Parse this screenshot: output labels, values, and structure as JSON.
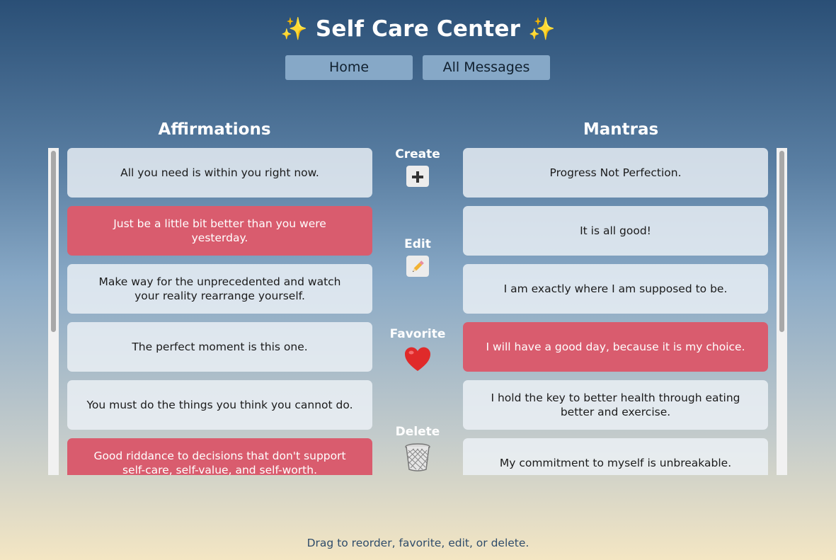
{
  "header": {
    "title": "✨ Self Care Center ✨"
  },
  "nav": {
    "home_label": "Home",
    "all_messages_label": "All Messages"
  },
  "affirmations": {
    "heading": "Affirmations",
    "items": [
      {
        "text": "All you need is within you right now.",
        "favorite": false
      },
      {
        "text": "Just be a little bit better than you were yesterday.",
        "favorite": true
      },
      {
        "text": "Make way for the unprecedented and watch your reality rearrange yourself.",
        "favorite": false
      },
      {
        "text": "The perfect moment is this one.",
        "favorite": false
      },
      {
        "text": "You must do the things you think you cannot do.",
        "favorite": false
      },
      {
        "text": "Good riddance to decisions that don't support self-care, self-value, and self-worth.",
        "favorite": true
      }
    ]
  },
  "mantras": {
    "heading": "Mantras",
    "items": [
      {
        "text": "Progress Not Perfection.",
        "favorite": false
      },
      {
        "text": "It is all good!",
        "favorite": false
      },
      {
        "text": "I am exactly where I am supposed to be.",
        "favorite": false
      },
      {
        "text": "I will have a good day, because it is my choice.",
        "favorite": true
      },
      {
        "text": "I hold the key to better health through eating better and exercise.",
        "favorite": false
      },
      {
        "text": "My commitment to myself is unbreakable.",
        "favorite": false
      }
    ]
  },
  "actions": {
    "create_label": "Create",
    "create_icon": "plus-icon",
    "edit_label": "Edit",
    "edit_icon": "pencil-icon",
    "favorite_label": "Favorite",
    "favorite_icon": "heart-icon",
    "delete_label": "Delete",
    "delete_icon": "trash-can-icon"
  },
  "footer": {
    "hint": "Drag to reorder, favorite, edit, or delete."
  },
  "colors": {
    "favorite_card": "#d95c6e",
    "card": "#edf2f6",
    "nav_button": "#86a8c7",
    "footer_text": "#2f4c6a"
  }
}
